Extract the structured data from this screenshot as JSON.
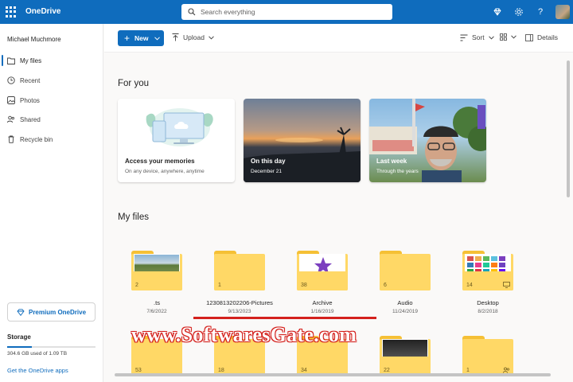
{
  "topbar": {
    "app_name": "OneDrive",
    "search_placeholder": "Search everything",
    "icons": [
      "waffle-icon",
      "diamond-icon",
      "gear-icon",
      "help-icon",
      "avatar"
    ]
  },
  "sidebar": {
    "user_name": "Michael Muchmore",
    "items": [
      {
        "label": "My files",
        "icon": "folder-icon",
        "active": true
      },
      {
        "label": "Recent",
        "icon": "clock-icon",
        "active": false
      },
      {
        "label": "Photos",
        "icon": "image-icon",
        "active": false
      },
      {
        "label": "Shared",
        "icon": "people-icon",
        "active": false
      },
      {
        "label": "Recycle bin",
        "icon": "trash-icon",
        "active": false
      }
    ],
    "premium_label": "Premium OneDrive",
    "storage_title": "Storage",
    "storage_text": "304.6 GB used of 1.09 TB",
    "storage_used_fraction": 0.28,
    "get_apps_label": "Get the OneDrive apps"
  },
  "commandbar": {
    "new_label": "New",
    "upload_label": "Upload",
    "sort_label": "Sort",
    "details_label": "Details"
  },
  "main": {
    "for_you_title": "For you",
    "cards": [
      {
        "title": "Access your memories",
        "subtitle": "On any device, anywhere, anytime"
      },
      {
        "title": "On this day",
        "subtitle": "December 21"
      },
      {
        "title": "Last week",
        "subtitle": "Through the years"
      }
    ],
    "my_files_title": "My files",
    "folders": [
      {
        "name": ".ts",
        "date": "7/6/2022",
        "count": "2"
      },
      {
        "name": "1230813202206-Pictures",
        "date": "9/13/2023",
        "count": "1"
      },
      {
        "name": "Archive",
        "date": "1/16/2019",
        "count": "38"
      },
      {
        "name": "Audio",
        "date": "11/24/2019",
        "count": "6"
      },
      {
        "name": "Desktop",
        "date": "8/2/2018",
        "count": "14"
      }
    ],
    "row2_counts": [
      "53",
      "18",
      "34",
      "22",
      "1"
    ]
  },
  "watermark": "www.SoftwaresGate.com",
  "colors": {
    "accent": "#0f6cbd",
    "folder": "#ffd866",
    "watermark": "#d4211d"
  }
}
